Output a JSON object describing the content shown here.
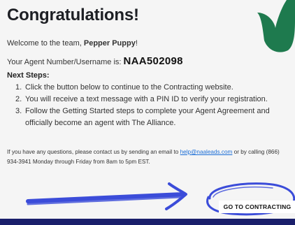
{
  "title": "Congratulations!",
  "welcome": {
    "prefix": "Welcome to the team, ",
    "name": "Pepper Puppy",
    "suffix": "!"
  },
  "agent": {
    "label": "Your Agent Number/Username is: ",
    "number": "NAA502098"
  },
  "next_steps": {
    "title": "Next Steps:",
    "items": [
      {
        "num": "1.",
        "text": "Click the button below to continue to the Contracting website."
      },
      {
        "num": "2.",
        "text": "You will receive a text message with a PIN ID to verify your registration."
      },
      {
        "num": "3.",
        "text": "Follow the Getting Started steps to complete your Agent Agreement and officially become an agent with The Alliance."
      }
    ]
  },
  "contact": {
    "prefix": "If you have any questions, please contact us by sending an email to ",
    "email": "help@naaleads.com",
    "suffix": " or by calling (866) 934-3941 Monday through Friday from 8am to 5pm EST."
  },
  "button": {
    "label": "GO TO CONTRACTING"
  },
  "colors": {
    "accent_green": "#1e7a4e",
    "bottom_bar": "#1a1f6b",
    "scribble": "#3b4cd9",
    "link": "#1a6dd6"
  },
  "icons": {
    "leaf": "leaf-decoration",
    "arrow": "hand-drawn-arrow"
  }
}
